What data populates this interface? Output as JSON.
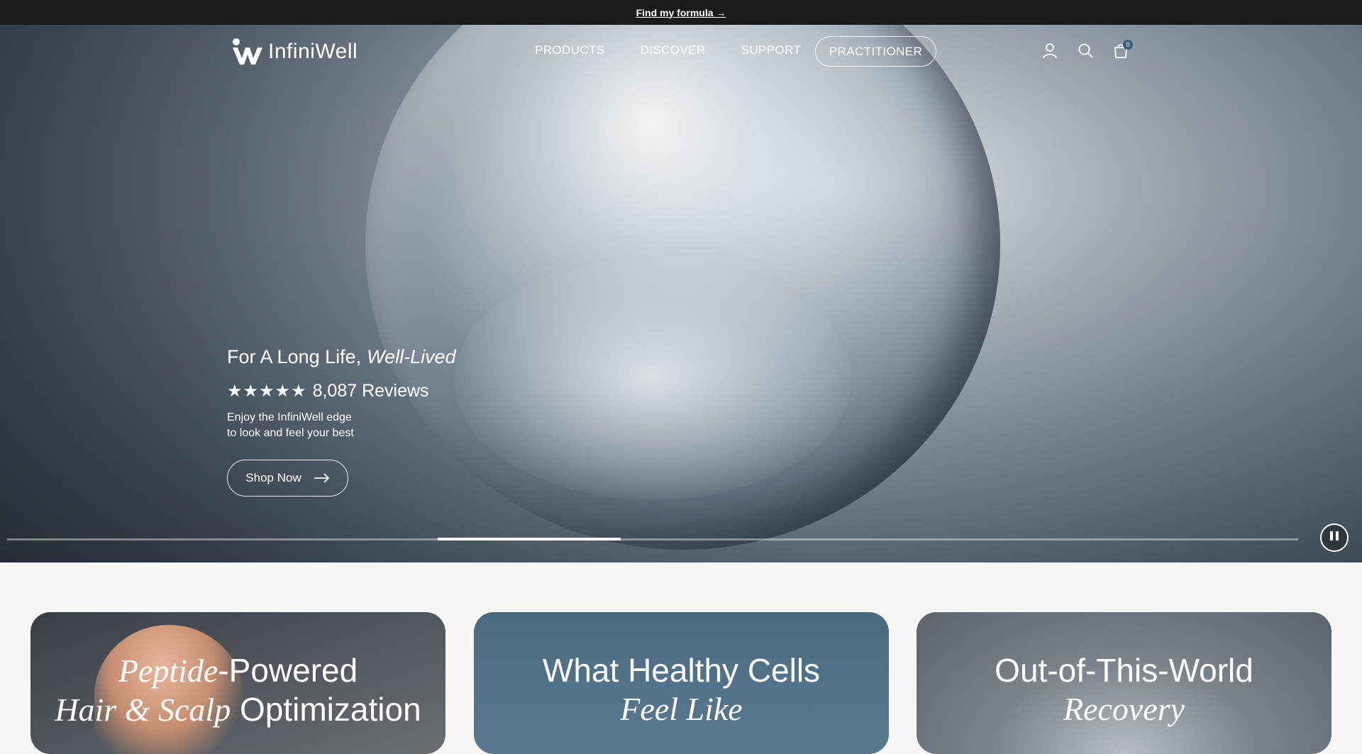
{
  "announcement": {
    "link_label": "Find my formula →"
  },
  "brand": {
    "name": "InfiniWell"
  },
  "nav": {
    "links": [
      "PRODUCTS",
      "DISCOVER",
      "SUPPORT"
    ],
    "practitioner_label": "PRACTITIONER",
    "icons": [
      "account-icon",
      "search-icon",
      "cart-icon"
    ],
    "cart_count": "0"
  },
  "hero": {
    "title_plain": "For A Long Life,",
    "title_italic": "Well-Lived",
    "stars": "★★★★★",
    "reviews_label": "8,087 Reviews",
    "description_line1": "Enjoy the InfiniWell edge",
    "description_line2": "to look and feel your best",
    "cta_label": "Shop Now",
    "slideshow_progress": 0.14
  },
  "cards": [
    {
      "title_italic": "Peptide",
      "title_rest": "-Powered",
      "line2_italic": "Hair & Scalp",
      "line2_rest": " Optimization"
    },
    {
      "title_plain": "What Healthy Cells",
      "line2_italic": "Feel Like"
    },
    {
      "title_plain": "Out-of-This-World",
      "line2_italic": "Recovery"
    }
  ],
  "colors": {
    "announce_bg": "#1b1b1b",
    "page_bg": "#f8f7f5",
    "accent": "#3b5f7a"
  }
}
